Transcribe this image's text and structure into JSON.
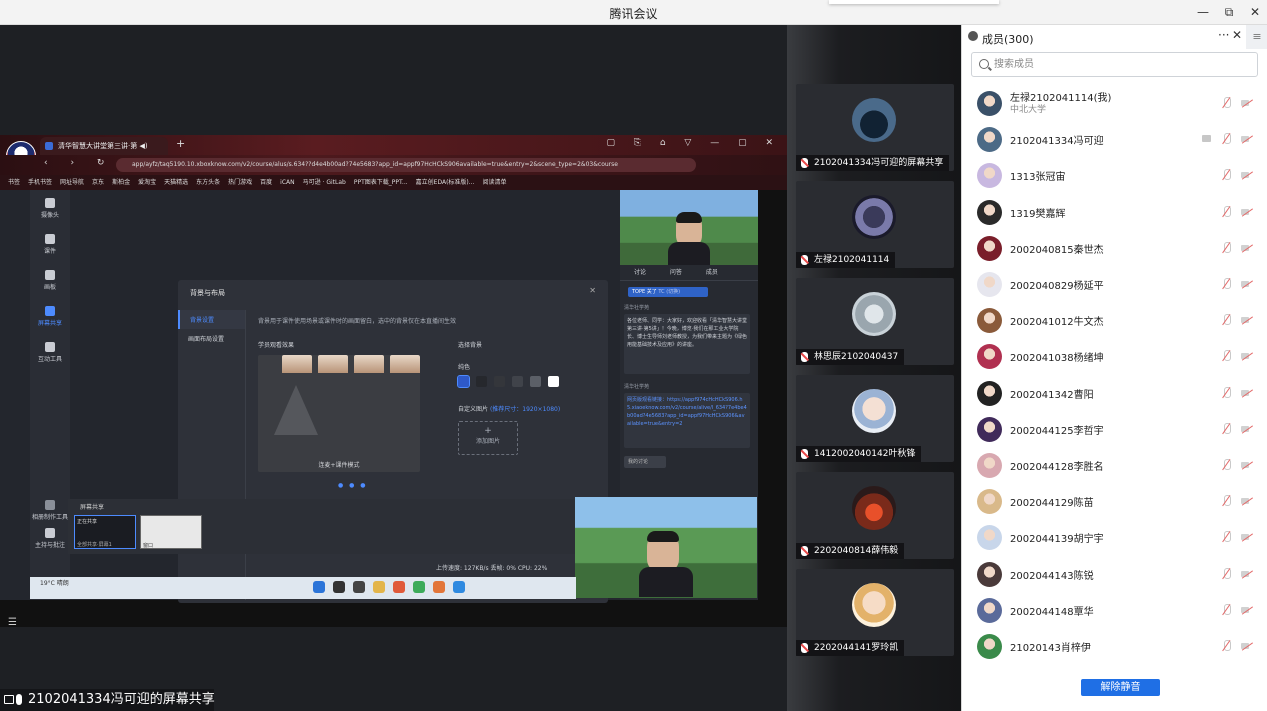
{
  "window": {
    "title": "腾讯会议",
    "controls": [
      "—",
      "⧉",
      "✕"
    ]
  },
  "browser": {
    "tab_title": "清华智慧大讲堂第三讲·第 ◀)",
    "url": "app/ayfz/taq5190.10.xboxknow.com/v2/course/alus/s.634??d4e4b00ad?74e5683?app_id=appf97HcHCkS906available=true&entry=2&scene_type=2&03&course",
    "bookmarks": [
      "书签",
      "手机书签",
      "网址导航",
      "京东",
      "斯柏金",
      "爱淘宝",
      "天猫精选",
      "东方头条",
      "热门游戏",
      "百度",
      "iCAN",
      "马可逊 · GitLab",
      "PPT图表下载_PPT...",
      "嘉立创EDA(标准版)...",
      "阅读清单"
    ]
  },
  "class_app": {
    "nav": [
      {
        "label": "摄像头"
      },
      {
        "label": "课件"
      },
      {
        "label": "画板"
      },
      {
        "label": "屏幕共享"
      },
      {
        "label": "互动工具"
      }
    ],
    "bottom_nav": [
      "相册制作工具",
      "主持与批注"
    ],
    "modal": {
      "title": "背景与布局",
      "side": [
        "背景设置",
        "画面布局设置"
      ],
      "description": "背景用于课件使用场景或课件时的画面留白，选中的背景仅在本直播间生效",
      "preview_label": "学员观看效果",
      "choose_bg": "选择背景",
      "solid_label": "纯色",
      "custom_label": "自定义图片",
      "custom_link": "(推荐尺寸：1920×1080)",
      "upload_label": "添加图片",
      "board_caption": "连麦+课件模式",
      "cancel": "取消",
      "confirm": "保存"
    },
    "side_tabs": "讨论 问答 成员",
    "chip_a": "TOPE 关了",
    "chip_b": "TC (切换)",
    "chat1_name": "清华社学苑",
    "chat1_text": "各位老师、同学：大家好，欢迎收看「清华智慧大讲堂第三讲·第5讲」！今晚，博览·我们在那工业大学院长、博士生导师刘老师教授，为我们带来主题为《绿色用能基础技术及应用》的讲座。",
    "chat2_name": "清华社学苑",
    "chat2_text": "网页版观看链接：https://appf974cHcHCkS906.h5.xiaoeknow.com/v2/course/alive/l_634?7e4be4b00ad?4e5683?app_id=appf97HcHCkS906&available=true&entry=2",
    "chat_input": "我的讨论",
    "screen_share_label": "屏幕共享",
    "screen_share_item1": "正在共享",
    "screen_share_item1_sub": "全部共享·屏幕1",
    "screen_share_item2": "窗口",
    "status": "上传速度:  127KB/s   丢帧:  0%   CPU:  22%",
    "weather": "19°C 晴朗"
  },
  "share_label": "2102041334冯可迎的屏幕共享",
  "tiles": [
    {
      "name": "2102041334冯可迎的屏幕共享"
    },
    {
      "name": "左禄2102041114"
    },
    {
      "name": "林思辰2102040437"
    },
    {
      "name": "1412002040142叶秋锋"
    },
    {
      "name": "2202040814薛伟毅"
    },
    {
      "name": "2202044141罗玲凯"
    }
  ],
  "members_panel": {
    "title": "成员(300)",
    "more": "···",
    "close": "✕",
    "menu": "≡",
    "search_placeholder": "搜索成员",
    "members": [
      {
        "name": "左禄2102041114(我)",
        "sub": "中北大学",
        "sharing": false
      },
      {
        "name": "2102041334冯可迎",
        "sub": "",
        "sharing": true
      },
      {
        "name": "1313张冠宙",
        "sub": "",
        "sharing": false
      },
      {
        "name": "1319樊嘉辉",
        "sub": "",
        "sharing": false
      },
      {
        "name": "2002040815秦世杰",
        "sub": "",
        "sharing": false
      },
      {
        "name": "2002040829杨延平",
        "sub": "",
        "sharing": false
      },
      {
        "name": "2002041012牛文杰",
        "sub": "",
        "sharing": false
      },
      {
        "name": "2002041038杨绪坤",
        "sub": "",
        "sharing": false
      },
      {
        "name": "2002041342曹阳",
        "sub": "",
        "sharing": false
      },
      {
        "name": "2002044125李哲宇",
        "sub": "",
        "sharing": false
      },
      {
        "name": "2002044128李胜名",
        "sub": "",
        "sharing": false
      },
      {
        "name": "2002044129陈苗",
        "sub": "",
        "sharing": false
      },
      {
        "name": "2002044139胡宁宇",
        "sub": "",
        "sharing": false
      },
      {
        "name": "2002044143陈锐",
        "sub": "",
        "sharing": false
      },
      {
        "name": "2002044148覃华",
        "sub": "",
        "sharing": false
      },
      {
        "name": "21020143肖梓伊",
        "sub": "",
        "sharing": false
      }
    ],
    "unmute_button": "解除静音"
  },
  "colors": {
    "accent": "#1f6fe5",
    "dark_bg": "#1e2024",
    "panel_bg": "#ffffff",
    "mic_off": "#e36a6a"
  }
}
